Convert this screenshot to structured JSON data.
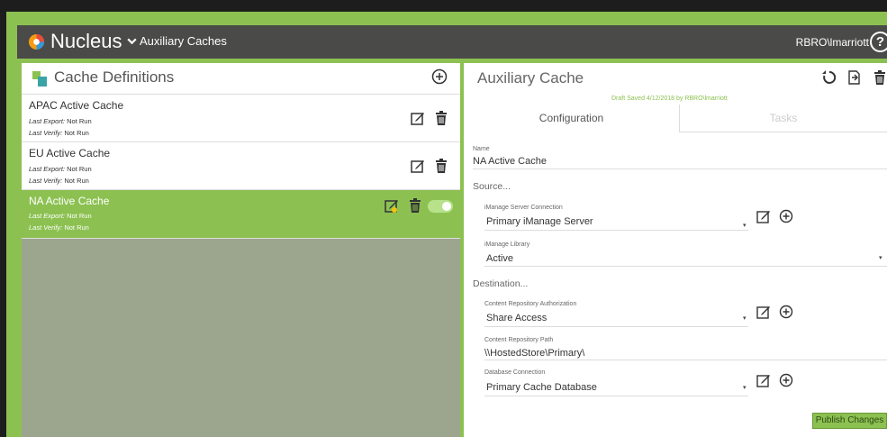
{
  "header": {
    "app_title": "Nucleus",
    "breadcrumb": "Auxiliary Caches",
    "user": "RBRO\\lmarriott",
    "help": "?"
  },
  "left_panel": {
    "title": "Cache Definitions",
    "items": [
      {
        "name": "APAC Active Cache",
        "export_label": "Last Export:",
        "export_value": "Not Run",
        "verify_label": "Last Verify:",
        "verify_value": "Not Run"
      },
      {
        "name": "EU Active Cache",
        "export_label": "Last Export:",
        "export_value": "Not Run",
        "verify_label": "Last Verify:",
        "verify_value": "Not Run"
      },
      {
        "name": "NA Active Cache",
        "export_label": "Last Export:",
        "export_value": "Not Run",
        "verify_label": "Last Verify:",
        "verify_value": "Not Run"
      }
    ]
  },
  "right_panel": {
    "title": "Auxiliary Cache",
    "draft_status": "Draft Saved 4/12/2018 by RBRO\\lmarriott",
    "tabs": [
      {
        "label": "Configuration"
      },
      {
        "label": "Tasks"
      }
    ],
    "name_label": "Name",
    "name_value": "NA Active Cache",
    "source_section": "Source...",
    "server_conn_label": "iManage Server Connection",
    "server_conn_value": "Primary iManage Server",
    "library_label": "iManage Library",
    "library_value": "Active",
    "dest_section": "Destination...",
    "auth_label": "Content Repository Authorization",
    "auth_value": "Share Access",
    "path_label": "Content Repository Path",
    "path_value": "\\\\HostedStore\\Primary\\",
    "db_label": "Database Connection",
    "db_value": "Primary Cache Database",
    "publish_label": "Publish Changes"
  },
  "colors": {
    "accent": "#8cc152",
    "header": "#4a4a48",
    "empty_area": "#9ca68f"
  }
}
